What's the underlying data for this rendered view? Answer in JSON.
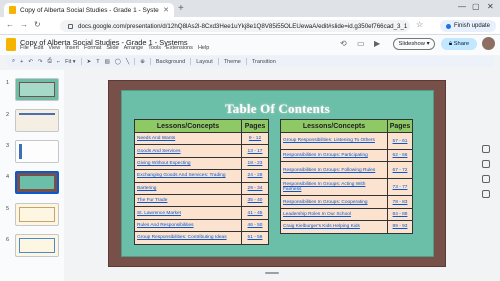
{
  "browser": {
    "tab_title": "Copy of Alberta Social Studies - Grade 1 - Systems - Google Slides",
    "url": "docs.google.com/presentation/d/12hQ8lAs2l-8Cxd3Hee1uYkj8e1Q8V85i55OLEUewaA/edit#slide=id.g350ef766cad_3_1",
    "finish_update_label": "Finish update"
  },
  "app": {
    "doc_title": "Copy of Alberta Social Studies - Grade 1 - Systems",
    "menus": [
      "File",
      "Edit",
      "View",
      "Insert",
      "Format",
      "Slide",
      "Arrange",
      "Tools",
      "Extensions",
      "Help"
    ],
    "slideshow_label": "Slideshow",
    "share_label": "Share"
  },
  "toolbar": {
    "zoom": "Fit",
    "background_label": "Background",
    "layout_label": "Layout",
    "theme_label": "Theme",
    "transition_label": "Transition"
  },
  "filmstrip": {
    "slide_numbers": [
      "1",
      "2",
      "3",
      "4",
      "5",
      "6"
    ],
    "selected": "4"
  },
  "slide": {
    "title": "Table Of Contents",
    "left_table": {
      "header_lessons": "Lessons/Concepts",
      "header_pages": "Pages",
      "rows": [
        {
          "lesson": "Needs And Wants",
          "pages": "9 - 12"
        },
        {
          "lesson": "Goods And Services",
          "pages": "13 - 17"
        },
        {
          "lesson": "Giving Without Expecting",
          "pages": "18 - 23"
        },
        {
          "lesson": "Exchanging Goods And Services: Trading",
          "pages": "24 - 28"
        },
        {
          "lesson": "Bartering",
          "pages": "29 - 34"
        },
        {
          "lesson": "The Fur Trade",
          "pages": "35 - 40"
        },
        {
          "lesson": "St. Lawrence Market",
          "pages": "41 - 45"
        },
        {
          "lesson": "Rules And Responsibilities",
          "pages": "46 - 50"
        },
        {
          "lesson": "Group Responsibilities: Contributing Ideas",
          "pages": "51 - 56"
        }
      ]
    },
    "right_table": {
      "header_lessons": "Lessons/Concepts",
      "header_pages": "Pages",
      "rows": [
        {
          "lesson": "Group Responsibilities: Listening To Others",
          "pages": "57 - 61"
        },
        {
          "lesson": "Responsibilities In Groups: Participating",
          "pages": "62 - 66"
        },
        {
          "lesson": "Responsibilities In Groups: Following Rules",
          "pages": "67 - 72"
        },
        {
          "lesson": "Responsibilities In Groups: Acting With Fairness",
          "pages": "73 - 77"
        },
        {
          "lesson": "Responsibilities In Groups: Cooperating",
          "pages": "78 - 83"
        },
        {
          "lesson": "Leadership Roles In Our School",
          "pages": "84 - 88"
        },
        {
          "lesson": "Craig Kielburger's Kids Helping Kids",
          "pages": "89 - 93"
        }
      ]
    }
  }
}
